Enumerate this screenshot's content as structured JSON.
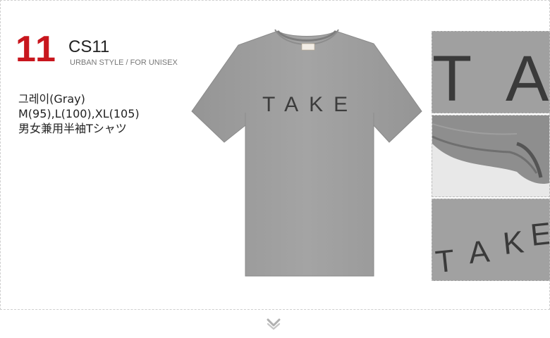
{
  "product": {
    "number": "11",
    "code": "CS11",
    "style": "URBAN STYLE / FOR UNISEX",
    "color": "그레이(Gray)",
    "sizes": "M(95),L(100),XL(105)",
    "description": "男女兼用半袖Tシャツ",
    "print_text": "TAKE"
  },
  "thumbnails": [
    {
      "letters": [
        "T",
        "A"
      ]
    },
    {},
    {
      "letters": [
        "T",
        "A",
        "K",
        "E"
      ]
    }
  ],
  "colors": {
    "number": "#c8161d",
    "shirt": "#9e9e9e",
    "print": "#3c3c3c"
  },
  "icons": {
    "scroll": "chevron-down-icon"
  }
}
